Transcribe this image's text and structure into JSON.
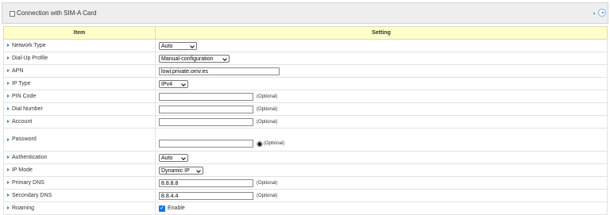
{
  "header": {
    "title": "Connection with SIM-A Card"
  },
  "table": {
    "col_item": "Item",
    "col_setting": "Setting",
    "rows": [
      {
        "label": "Network Type",
        "value": "Auto"
      },
      {
        "label": "Dial-Up Profile",
        "value": "Manual-configuration"
      },
      {
        "label": "APN",
        "value": "lowi.private.omv.es"
      },
      {
        "label": "IP Type",
        "value": "IPv4"
      },
      {
        "label": "PIN Code",
        "value": "",
        "hint": "(Optional)"
      },
      {
        "label": "Dial Number",
        "value": "",
        "hint": "(Optional)"
      },
      {
        "label": "Account",
        "value": "",
        "hint": "(Optional)"
      },
      {
        "label": "Password",
        "value": "",
        "hint": "(Optional)"
      },
      {
        "label": "Authentication",
        "value": "Auto"
      },
      {
        "label": "IP Mode",
        "value": "Dynamic IP"
      },
      {
        "label": "Primary DNS",
        "value": "8.8.8.8",
        "hint": "(Optional)"
      },
      {
        "label": "Secondary DNS",
        "value": "8.8.4.4",
        "hint": "(Optional)"
      },
      {
        "label": "Roaming",
        "checked": true,
        "checkbox_label": "Enable"
      }
    ]
  },
  "icons": {
    "header": "square-bullet-icon",
    "collapse": "collapse-toggle-icon",
    "row": "triangle-arrow-icon",
    "password": "eye-icon"
  },
  "colors": {
    "header_bg": "#eeeeee",
    "table_header_bg": "#fffdc8",
    "accent": "#1a73e8"
  }
}
